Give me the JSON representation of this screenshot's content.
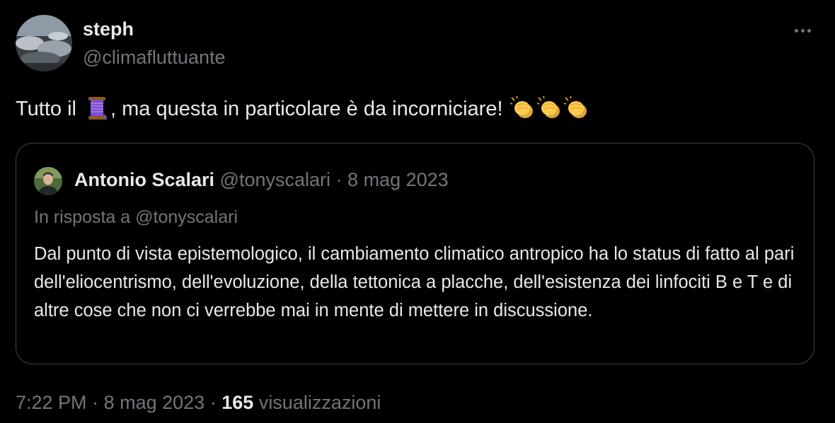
{
  "tweet": {
    "author": {
      "display_name": "steph",
      "handle": "@climafluttuante"
    },
    "text_before": "Tutto il ",
    "text_after": ", ma questa in particolare è da incorniciare! ",
    "icons": [
      "thread-spool-icon",
      "clapping-hands-icon",
      "clapping-hands-icon",
      "clapping-hands-icon"
    ],
    "more_icon": "more-options-icon"
  },
  "quote": {
    "author": {
      "display_name": "Antonio Scalari",
      "handle": "@tonyscalari"
    },
    "separator": "·",
    "date": "8 mag 2023",
    "reply_to": "In risposta a @tonyscalari",
    "text": "Dal punto di vista epistemologico, il cambiamento climatico antropico ha lo status di fatto al pari dell'eliocentrismo, dell'evoluzione, della tettonica a placche, dell'esistenza dei linfociti B e T e di altre cose che non ci verrebbe mai in mente di mettere in discussione."
  },
  "footer": {
    "time": "7:22 PM",
    "separator": "·",
    "date": "8 mag 2023",
    "views_count": "165",
    "views_label": "visualizzazioni"
  },
  "colors": {
    "background": "#000000",
    "text_primary": "#e7e9ea",
    "text_secondary": "#71767b",
    "border": "#3d4145"
  }
}
